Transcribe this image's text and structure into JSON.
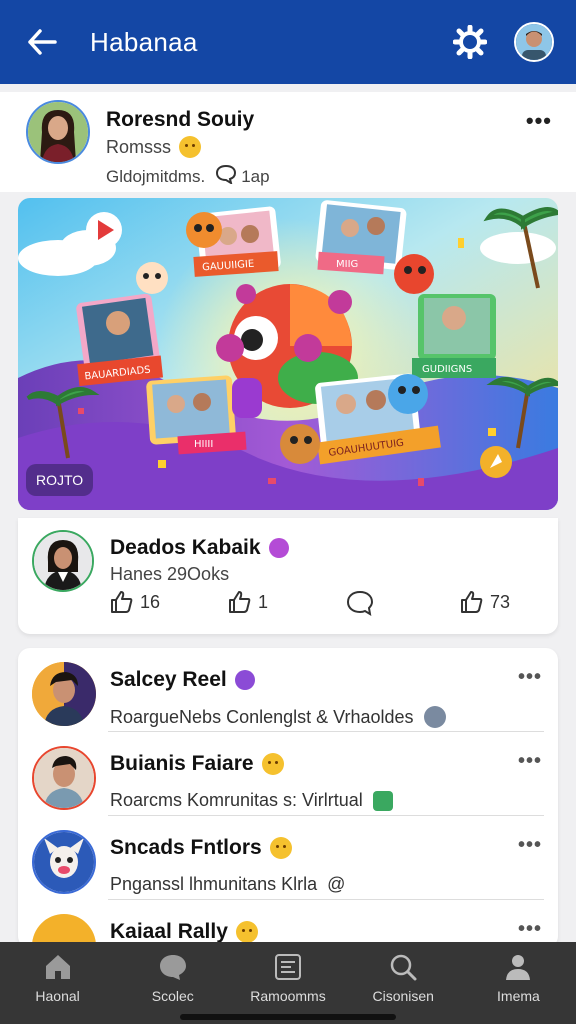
{
  "header": {
    "title": "Habanaa",
    "back_icon": "back-arrow-icon",
    "settings_icon": "gear-icon"
  },
  "post": {
    "author": "Roresnd Souiy",
    "subtitle": "Romsss",
    "meta": "Gldojmitdms.",
    "comment_time": "1ap"
  },
  "banner": {
    "tag": "ROJTO",
    "ribbon_1": "GAUUIIGIE",
    "ribbon_2": "MIIG",
    "ribbon_3": "BAUARDIADS",
    "ribbon_4": "GUDIIGNS",
    "ribbon_5": "HIIII",
    "ribbon_6": "GOAUHUUTUIG"
  },
  "reaction_card": {
    "name": "Deados Kabaik",
    "subtitle": "Hanes 29Ooks",
    "like_count_1": "16",
    "like_count_2": "1",
    "like_count_3": "73"
  },
  "list": [
    {
      "name": "Salcey Reel",
      "description": "RoargueNebs Conlenglst & Vrhaoldes"
    },
    {
      "name": "Buianis Faiare",
      "description": "Roarcms Komrunitas s: Virlrtual"
    },
    {
      "name": "Sncads Fntlors",
      "description": "Pnganssl lhmunitans Klrla"
    },
    {
      "name": "Kaiaal Rally",
      "description": ""
    }
  ],
  "nav": {
    "items": [
      {
        "label": "Haonal",
        "icon": "home-icon"
      },
      {
        "label": "Scolec",
        "icon": "chat-icon"
      },
      {
        "label": "Ramoomms",
        "icon": "document-icon"
      },
      {
        "label": "Cisonisen",
        "icon": "search-icon"
      },
      {
        "label": "Imema",
        "icon": "person-icon"
      }
    ]
  },
  "colors": {
    "header": "#1447a5",
    "nav": "#363636",
    "accent_green": "#3aa860"
  }
}
